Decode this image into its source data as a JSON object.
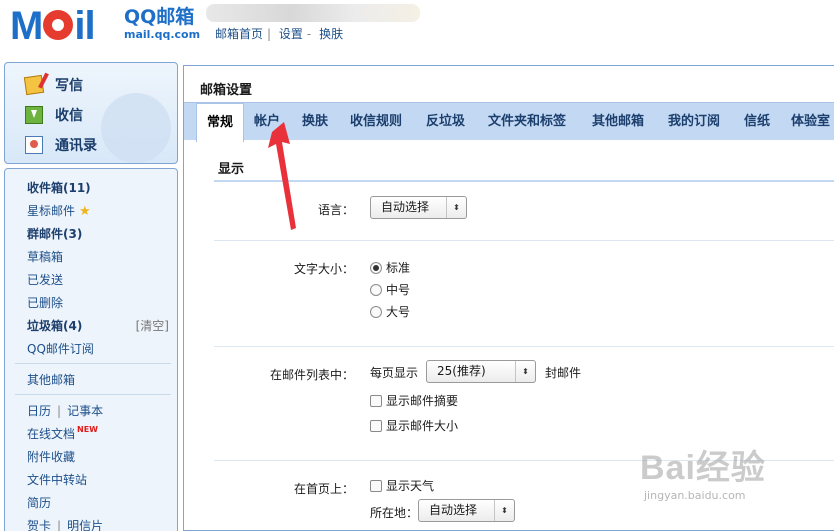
{
  "header": {
    "logo_text": "Mail",
    "logo_qq": "QQ邮箱",
    "logo_url": "mail.qq.com",
    "links": [
      "邮箱首页",
      "设置",
      "换肤"
    ]
  },
  "sidebar": {
    "compose": [
      {
        "label": "写信",
        "icon": "write-icon"
      },
      {
        "label": "收信",
        "icon": "inbox-download-icon"
      },
      {
        "label": "通讯录",
        "icon": "address-book-icon"
      }
    ],
    "folders": {
      "inbox": "收件箱(11)",
      "starred": "星标邮件",
      "group": "群邮件(3)",
      "drafts": "草稿箱",
      "sent": "已发送",
      "deleted": "已删除",
      "spam": "垃圾箱(4)",
      "spam_clean": "[清空]",
      "subscriptions": "QQ邮件订阅",
      "other_mail": "其他邮箱",
      "calendar": "日历",
      "notes": "记事本",
      "docs": "在线文档",
      "docs_badge": "NEW",
      "attachments": "附件收藏",
      "transfer": "文件中转站",
      "resume": "简历",
      "cards": "贺卡",
      "postcards": "明信片"
    }
  },
  "main": {
    "title": "邮箱设置",
    "tabs": [
      "常规",
      "帐户",
      "换肤",
      "收信规则",
      "反垃圾",
      "文件夹和标签",
      "其他邮箱",
      "我的订阅",
      "信纸",
      "体验室"
    ],
    "active_tab": "常规",
    "section": "显示",
    "language": {
      "label": "语言：",
      "value": "自动选择"
    },
    "font_size": {
      "label": "文字大小：",
      "options": [
        "标准",
        "中号",
        "大号"
      ],
      "selected": "标准"
    },
    "mail_list": {
      "label": "在邮件列表中：",
      "per_page_prefix": "每页显示",
      "per_page_value": "25(推荐)",
      "per_page_suffix": "封邮件",
      "show_summary": "显示邮件摘要",
      "show_size": "显示邮件大小"
    },
    "homepage": {
      "label": "在首页上：",
      "show_weather": "显示天气",
      "location_label": "所在地：",
      "location_value": "自动选择"
    }
  },
  "watermark": {
    "text": "Bai经验",
    "url": "jingyan.baidu.com"
  },
  "colors": {
    "accent": "#1d6fc8",
    "tabbar": "#c3d9f3",
    "sidebar_bg": "#eef4fb",
    "arrow": "#e8313a"
  }
}
